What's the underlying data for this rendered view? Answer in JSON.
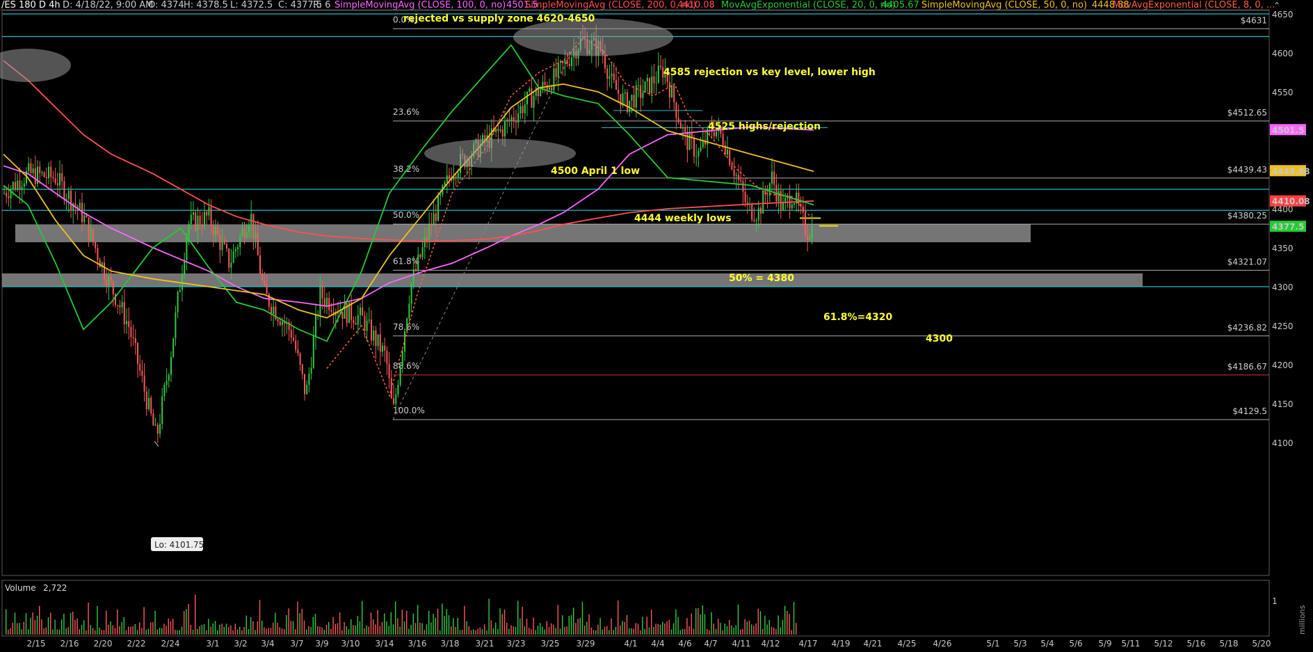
{
  "header": {
    "symbol": "/ES 180 D 4h",
    "date": "D: 4/18/22, 9:00 AM",
    "open": "O: 4374",
    "high": "H: 4378.5",
    "low": "L: 4372.5",
    "close": "C: 4377.5",
    "range": "R: 6",
    "studies": [
      {
        "label": "SimpleMovingAvg (CLOSE, 100, 0, no)",
        "value": "4501.5",
        "color": "#ff66ff"
      },
      {
        "label": "SimpleMovingAvg (CLOSE, 200, 0, no)",
        "value": "4410.08",
        "color": "#ff5050"
      },
      {
        "label": "MovAvgExponential (CLOSE, 20, 0, no)",
        "value": "4405.67",
        "color": "#22cc33"
      },
      {
        "label": "SimpleMovingAvg (CLOSE, 50, 0, no)",
        "value": "4448.88",
        "color": "#f0c020"
      },
      {
        "label": "MovAvgExponential (CLOSE, 8, 0, ...",
        "value": "",
        "color": "#ff6040"
      }
    ]
  },
  "price_axis": {
    "ticks": [
      "4650",
      "4600",
      "4550",
      "4500",
      "4450",
      "4400",
      "4350",
      "4300",
      "4250",
      "4200",
      "4150",
      "4100"
    ],
    "tags": [
      {
        "value": "4501.5",
        "color": "#ff66ff",
        "price": 4501.5
      },
      {
        "value": "4448.88",
        "color": "#f0c020",
        "price": 4448.88
      },
      {
        "value": "4410.08",
        "color": "#ff4040",
        "price": 4410.08
      },
      {
        "value": "4377.5",
        "color": "#22cc33",
        "price": 4377.5
      }
    ]
  },
  "date_axis": [
    "2/15",
    "2/16",
    "2/20",
    "2/22",
    "2/24",
    "3/1",
    "3/2",
    "3/4",
    "3/7",
    "3/9",
    "3/10",
    "3/14",
    "3/16",
    "3/18",
    "3/21",
    "3/23",
    "3/25",
    "3/29",
    "4/1",
    "4/4",
    "4/6",
    "4/7",
    "4/11",
    "4/12",
    "4/17",
    "4/19",
    "4/21",
    "4/25",
    "4/26",
    "5/1",
    "5/3",
    "5/4",
    "5/6",
    "5/9",
    "5/11",
    "5/12",
    "5/16",
    "5/18",
    "5/20"
  ],
  "fib_levels": [
    {
      "pct": "0.0%",
      "price": "$4631",
      "level": 4631,
      "color": "#cccccc"
    },
    {
      "pct": "23.6%",
      "price": "$4512.65",
      "level": 4512.65,
      "color": "#cccccc"
    },
    {
      "pct": "38.2%",
      "price": "$4439.43",
      "level": 4439.43,
      "color": "#cccccc"
    },
    {
      "pct": "50.0%",
      "price": "$4380.25",
      "level": 4380.25,
      "color": "#cccccc"
    },
    {
      "pct": "61.8%",
      "price": "$4321.07",
      "level": 4321.07,
      "color": "#cccccc"
    },
    {
      "pct": "78.6%",
      "price": "$4236.82",
      "level": 4236.82,
      "color": "#cccccc"
    },
    {
      "pct": "88.6%",
      "price": "$4186.67",
      "level": 4186.67,
      "color": "#ff4040"
    },
    {
      "pct": "100.0%",
      "price": "$4129.5",
      "level": 4129.5,
      "color": "#cccccc"
    }
  ],
  "annotations": {
    "supply_zone": "rejected vs supply zone 4620-4650",
    "rejection_4585": "4585 rejection vs key level, lower high",
    "highs_4525": "4525 highs/rejection",
    "april1_low": "4500 April 1 low",
    "weekly_lows": "4444 weekly lows",
    "fib50": "50% = 4380",
    "fib618": "61.8%=4320",
    "level4300": "4300",
    "low_label": "Lo: 4101.75"
  },
  "volume": {
    "label": "Volume",
    "value": "2,722",
    "scale_label": "1",
    "unit_label": "millions"
  },
  "chart_data": {
    "type": "line",
    "title": "/ES 180 D 4h",
    "ylim": [
      4075,
      4660
    ],
    "x": [
      "2/15",
      "2/16",
      "2/20",
      "2/22",
      "2/24",
      "3/1",
      "3/2",
      "3/4",
      "3/7",
      "3/9",
      "3/10",
      "3/14",
      "3/16",
      "3/18",
      "3/21",
      "3/23",
      "3/25",
      "3/29",
      "4/1",
      "4/4",
      "4/6",
      "4/7",
      "4/11",
      "4/12",
      "4/17"
    ],
    "series": [
      {
        "name": "SimpleMovingAvg (CLOSE, 100, 0, no)",
        "color": "#ff66ff",
        "values": [
          4455,
          4445,
          4420,
          4395,
          4375,
          4350,
          4335,
          4320,
          4300,
          4285,
          4280,
          4275,
          4285,
          4305,
          4320,
          4330,
          4350,
          4365,
          4380,
          4395,
          4425,
          4470,
          4495,
          4505,
          4501
        ]
      },
      {
        "name": "SimpleMovingAvg (CLOSE, 200, 0, no)",
        "color": "#ff5050",
        "values": [
          4590,
          4565,
          4530,
          4495,
          4470,
          4445,
          4425,
          4405,
          4390,
          4380,
          4370,
          4365,
          4362,
          4360,
          4358,
          4359,
          4361,
          4365,
          4372,
          4380,
          4388,
          4395,
          4400,
          4406,
          4410
        ]
      },
      {
        "name": "MovAvgExponential (CLOSE, 20, 0, no)",
        "color": "#22cc33",
        "values": [
          4430,
          4405,
          4330,
          4245,
          4280,
          4350,
          4375,
          4325,
          4280,
          4270,
          4245,
          4230,
          4320,
          4420,
          4480,
          4525,
          4575,
          4610,
          4555,
          4545,
          4535,
          4495,
          4440,
          4430,
          4405
        ]
      },
      {
        "name": "SimpleMovingAvg (CLOSE, 50, 0, no)",
        "color": "#f0c020",
        "values": [
          4470,
          4440,
          4385,
          4340,
          4320,
          4310,
          4305,
          4300,
          4295,
          4290,
          4270,
          4260,
          4285,
          4340,
          4395,
          4440,
          4490,
          4530,
          4555,
          4560,
          4550,
          4530,
          4500,
          4470,
          4448
        ]
      }
    ]
  }
}
